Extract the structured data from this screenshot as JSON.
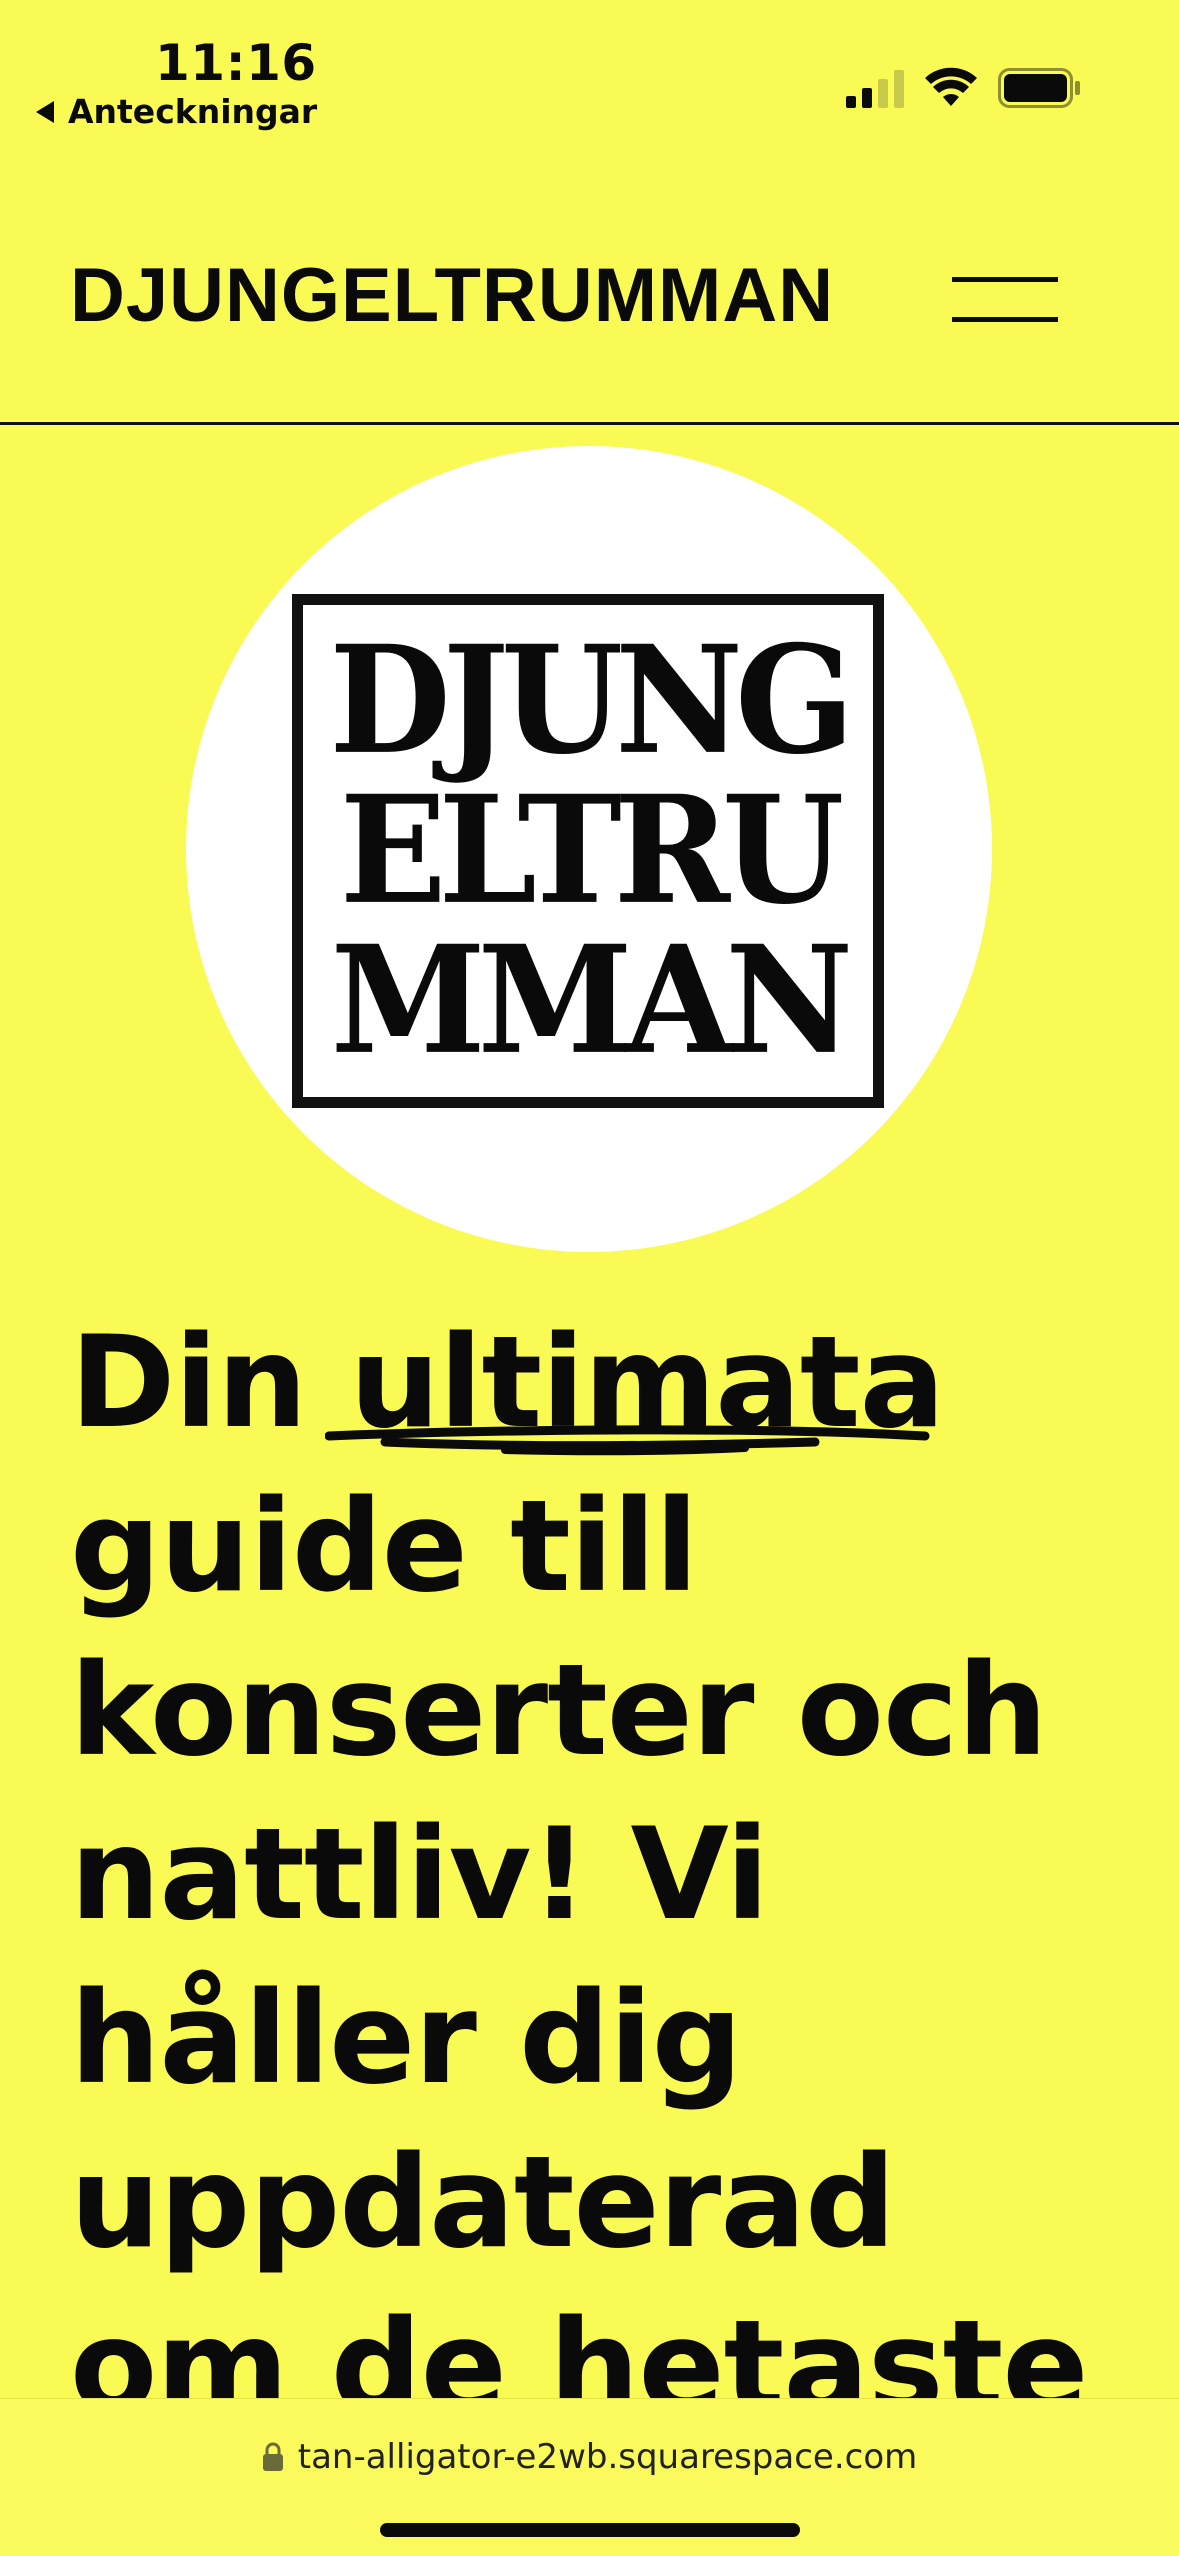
{
  "status_bar": {
    "time": "11:16",
    "back_label": "Anteckningar"
  },
  "header": {
    "site_title": "DJUNGELTRUMMAN"
  },
  "logo": {
    "lines": [
      "DJUNG",
      "ELTRU",
      "MMAN"
    ]
  },
  "hero": {
    "before": "Din ",
    "highlight": "ultimata",
    "after": " guide till konserter och nattliv! Vi håller dig uppdaterad om de hetaste"
  },
  "address_bar": {
    "url": "tan-alligator-e2wb.squarespace.com"
  },
  "colors": {
    "background": "#fafa55",
    "text": "#0a0a0a",
    "logo_circle": "#ffffff"
  }
}
